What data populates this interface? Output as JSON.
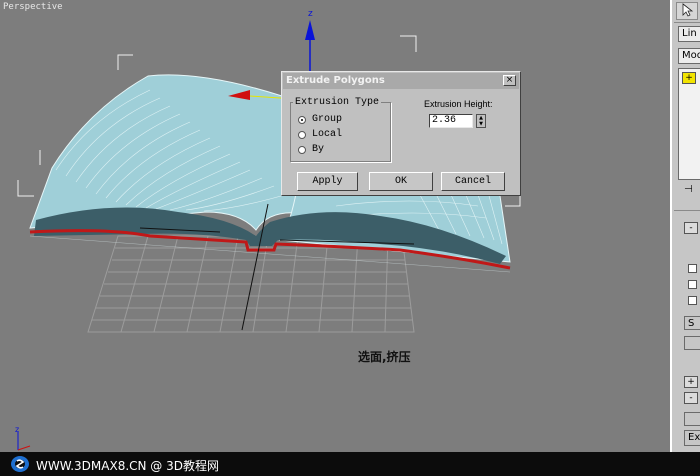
{
  "viewport": {
    "label": "Perspective",
    "caption": "选面,挤压",
    "axis_label": "z"
  },
  "dialog": {
    "title": "Extrude Polygons",
    "close_glyph": "×",
    "group_label": "Extrusion Type",
    "options": [
      "Group",
      "Local",
      "By"
    ],
    "selected_option": "Group",
    "height_label": "Extrusion Height:",
    "height_value": "2.36",
    "apply": "Apply",
    "ok": "OK",
    "cancel": "Cancel"
  },
  "command_panel": {
    "list_label": "Lin",
    "modifier_label": "Mod",
    "sign_plus": "+",
    "sign_minus": "-",
    "sub_button": "S",
    "exit_button": "Ex"
  },
  "watermark": {
    "text": "WWW.3DMAX8.CN @ 3D教程网"
  },
  "colors": {
    "viewport_bg": "#7d7d7d",
    "mesh_top": "#9fcfd8",
    "mesh_wire": "#e6f6f8",
    "page_inner": "#3c5e68",
    "edge_red": "#c01818",
    "axis_blue": "#0a14d8",
    "axis_red": "#d01010"
  }
}
